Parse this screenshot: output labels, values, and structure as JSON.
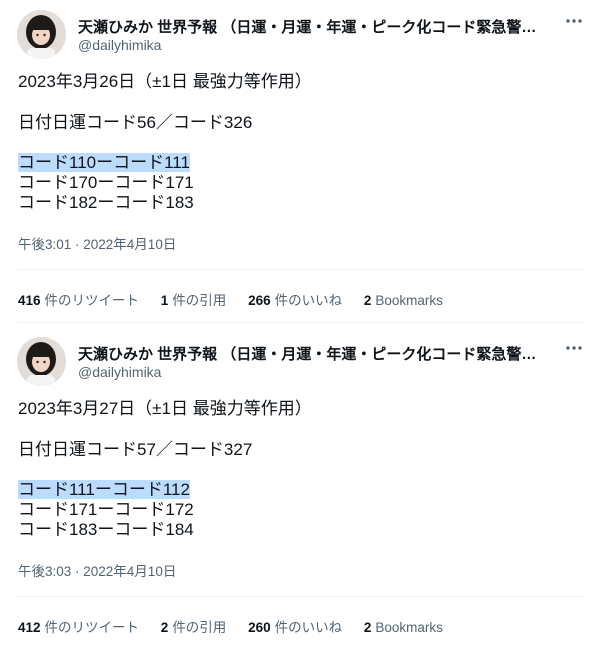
{
  "tweets": [
    {
      "author_name": "天瀬ひみか 世界予報 （日運・月運・年運・ピーク化コード緊急警…",
      "author_handle": "@dailyhimika",
      "more_icon": "more-horizontal-icon",
      "lines": [
        "2023年3月26日（±1日 最強力等作用）",
        "日付日運コード56／コード326",
        "コード110ーコード111",
        "コード170ーコード171",
        "コード182ーコード183"
      ],
      "highlighted_line_index": 2,
      "timestamp": "午後3:01 · 2022年4月10日",
      "stats": [
        {
          "value": "416",
          "label": "件のリツイート"
        },
        {
          "value": "1",
          "label": "件の引用"
        },
        {
          "value": "266",
          "label": "件のいいね"
        },
        {
          "value": "2",
          "label": "Bookmarks"
        }
      ]
    },
    {
      "author_name": "天瀬ひみか 世界予報 （日運・月運・年運・ピーク化コード緊急警…",
      "author_handle": "@dailyhimika",
      "more_icon": "more-horizontal-icon",
      "lines": [
        "2023年3月27日（±1日 最強力等作用）",
        "日付日運コード57／コード327",
        "コード111ーコード112",
        "コード171ーコード172",
        "コード183ーコード184"
      ],
      "highlighted_line_index": 2,
      "timestamp": "午後3:03 · 2022年4月10日",
      "stats": [
        {
          "value": "412",
          "label": "件のリツイート"
        },
        {
          "value": "2",
          "label": "件の引用"
        },
        {
          "value": "260",
          "label": "件のいいね"
        },
        {
          "value": "2",
          "label": "Bookmarks"
        }
      ]
    }
  ],
  "colors": {
    "text_primary": "#0f1419",
    "text_secondary": "#536471",
    "divider": "#eff3f4",
    "selection_highlight": "#bcdcff"
  }
}
